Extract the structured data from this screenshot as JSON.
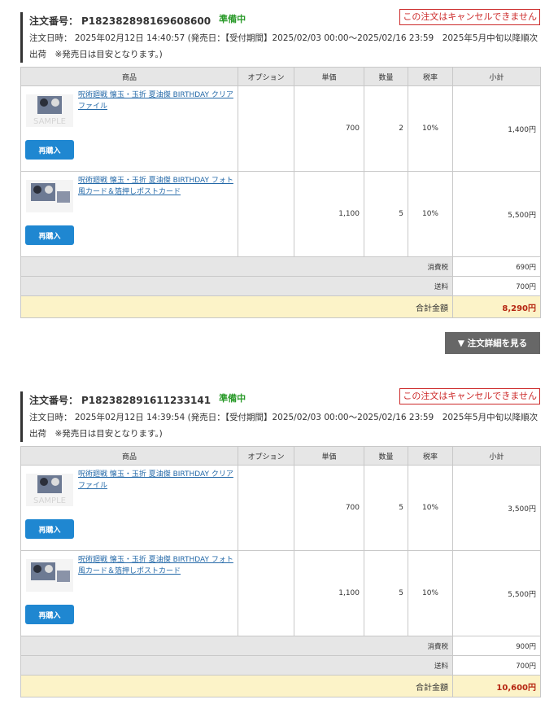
{
  "orders": [
    {
      "label": "注文番号：",
      "number": "P182382898169608600",
      "status": "準備中",
      "no_cancel": "この注文はキャンセルできません",
      "date_line1": "注文日時： 2025年02月12日 14:40:57 (発売日：【受付期間】2025/02/03 00:00～2025/02/16 23:59　2025年5月中旬以降順次",
      "date_line2": "出荷　※発売日は目安となります。)",
      "columns": [
        "商品",
        "オプション",
        "単価",
        "数量",
        "税率",
        "小計"
      ],
      "items": [
        {
          "name": "呪術廻戦 懐玉・玉折 夏油傑 BIRTHDAY クリアファイル",
          "option": "",
          "price": "700",
          "qty": "2",
          "tax": "10%",
          "subtotal": "1,400円",
          "rebuy": "再購入",
          "thumb_text": "SAMPLE"
        },
        {
          "name": "呪術廻戦 懐玉・玉折 夏油傑 BIRTHDAY フォト風カード＆箔押しポストカード",
          "option": "",
          "price": "1,100",
          "qty": "5",
          "tax": "10%",
          "subtotal": "5,500円",
          "rebuy": "再購入",
          "thumb_text": ""
        }
      ],
      "tax_label": "消費税",
      "tax_value": "690円",
      "ship_label": "送料",
      "ship_value": "700円",
      "total_label": "合計金額",
      "total_value": "8,290円"
    },
    {
      "label": "注文番号：",
      "number": "P182382891611233141",
      "status": "準備中",
      "no_cancel": "この注文はキャンセルできません",
      "date_line1": "注文日時： 2025年02月12日 14:39:54 (発売日：【受付期間】2025/02/03 00:00～2025/02/16 23:59　2025年5月中旬以降順次",
      "date_line2": "出荷　※発売日は目安となります。)",
      "columns": [
        "商品",
        "オプション",
        "単価",
        "数量",
        "税率",
        "小計"
      ],
      "items": [
        {
          "name": "呪術廻戦 懐玉・玉折 夏油傑 BIRTHDAY クリアファイル",
          "option": "",
          "price": "700",
          "qty": "5",
          "tax": "10%",
          "subtotal": "3,500円",
          "rebuy": "再購入",
          "thumb_text": "SAMPLE"
        },
        {
          "name": "呪術廻戦 懐玉・玉折 夏油傑 BIRTHDAY フォト風カード＆箔押しポストカード",
          "option": "",
          "price": "1,100",
          "qty": "5",
          "tax": "10%",
          "subtotal": "5,500円",
          "rebuy": "再購入",
          "thumb_text": ""
        }
      ],
      "tax_label": "消費税",
      "tax_value": "900円",
      "ship_label": "送料",
      "ship_value": "700円",
      "total_label": "合計金額",
      "total_value": "10,600円"
    }
  ],
  "detail_button": "▼ 注文詳細を見る",
  "colors": {
    "status": "#2a9a2a",
    "cancel": "#cc2a2a",
    "link": "#2469a8",
    "button": "#1f87d1",
    "total": "#b5240f",
    "total_bg": "#fcf3c8"
  }
}
